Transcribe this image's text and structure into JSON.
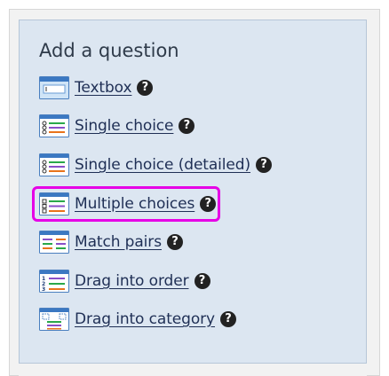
{
  "panel": {
    "title": "Add a question"
  },
  "question_types": [
    {
      "label": "Textbox",
      "icon": "textbox-icon"
    },
    {
      "label": "Single choice",
      "icon": "single-choice-icon"
    },
    {
      "label": "Single choice (detailed)",
      "icon": "single-choice-detailed-icon"
    },
    {
      "label": "Multiple choices",
      "icon": "multiple-choices-icon"
    },
    {
      "label": "Match pairs",
      "icon": "match-pairs-icon"
    },
    {
      "label": "Drag into order",
      "icon": "drag-into-order-icon"
    },
    {
      "label": "Drag into category",
      "icon": "drag-into-category-icon"
    }
  ],
  "help_icon": "?",
  "highlighted_item": "Multiple choices",
  "colors": {
    "highlight": "#e600e6",
    "panel_bg": "#dce6f1",
    "link": "#1f2f55"
  }
}
